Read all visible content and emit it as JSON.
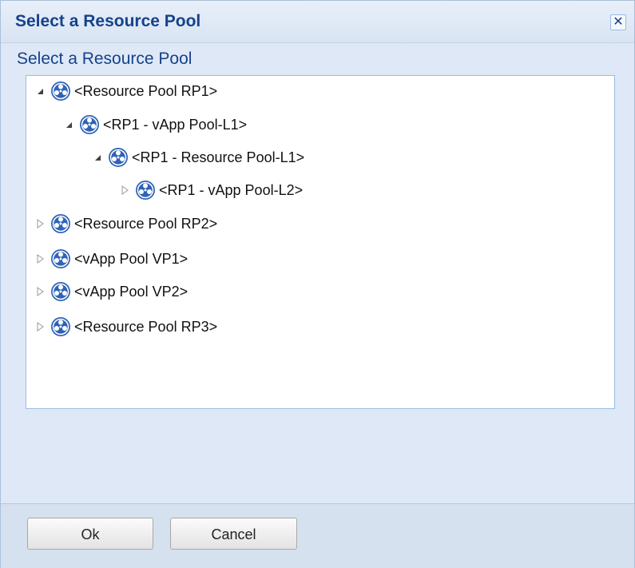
{
  "dialog": {
    "title": "Select a Resource Pool",
    "close_glyph": "✕",
    "panel_label": "Select a Resource Pool"
  },
  "tree": {
    "nodes": [
      {
        "label": "<Resource Pool RP1>",
        "expanded": true,
        "icon": "resource-pool-icon"
      },
      {
        "label": "<RP1 - vApp Pool-L1>",
        "expanded": true,
        "icon": "resource-pool-icon"
      },
      {
        "label": "<RP1 - Resource Pool-L1>",
        "expanded": true,
        "icon": "resource-pool-icon"
      },
      {
        "label": "<RP1 - vApp Pool-L2>",
        "expanded": false,
        "icon": "resource-pool-icon"
      },
      {
        "label": "<Resource Pool RP2>",
        "expanded": false,
        "icon": "resource-pool-icon"
      },
      {
        "label": "<vApp Pool VP1>",
        "expanded": false,
        "icon": "resource-pool-icon"
      },
      {
        "label": "<vApp Pool VP2>",
        "expanded": false,
        "icon": "resource-pool-icon"
      },
      {
        "label": "<Resource Pool RP3>",
        "expanded": false,
        "icon": "resource-pool-icon"
      }
    ]
  },
  "buttons": {
    "ok_label": "Ok",
    "cancel_label": "Cancel"
  },
  "colors": {
    "title_text": "#15428b",
    "icon_blue": "#2f63b7",
    "panel_background": "#dfe8f6"
  }
}
